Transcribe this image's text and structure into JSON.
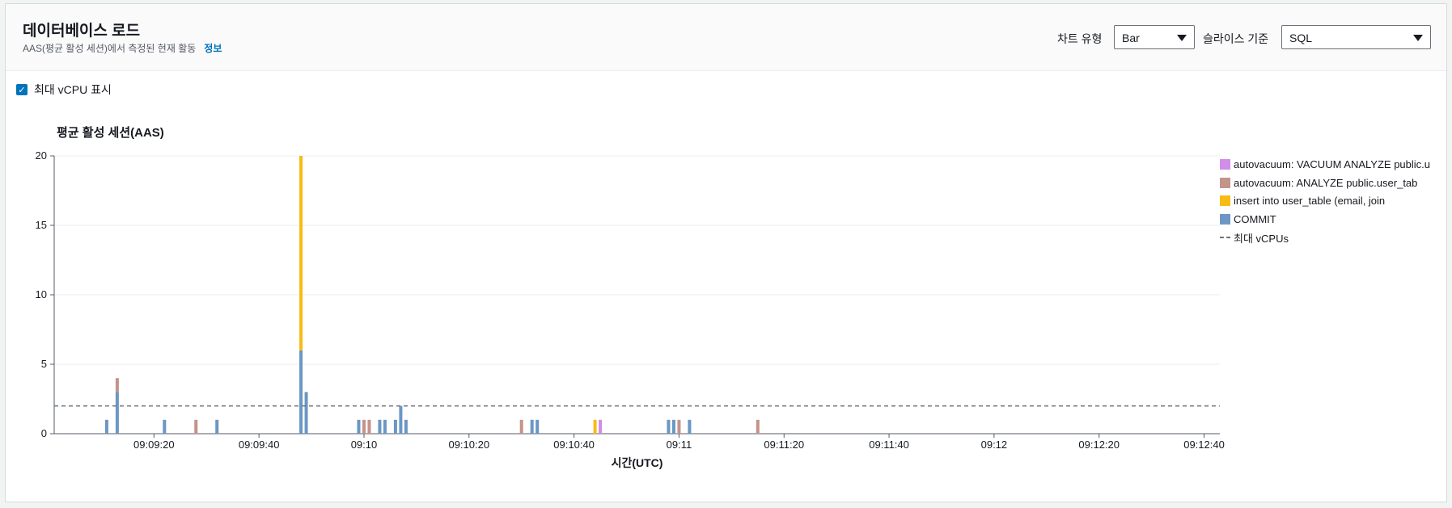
{
  "header": {
    "title": "데이터베이스 로드",
    "subtitle": "AAS(평균 활성 세션)에서 측정된 현재 활동",
    "info_link": "정보"
  },
  "controls": {
    "chart_type_label": "차트 유형",
    "chart_type_value": "Bar",
    "slice_label": "슬라이스 기준",
    "slice_value": "SQL"
  },
  "checkbox": {
    "label": "최대 vCPU 표시",
    "checked": true
  },
  "legend": [
    {
      "name": "autovacuum: VACUUM ANALYZE public.u",
      "color": "#d08ee8"
    },
    {
      "name": "autovacuum: ANALYZE public.user_tab",
      "color": "#c4938a"
    },
    {
      "name": "insert into user_table (email, join",
      "color": "#f8bb16"
    },
    {
      "name": "COMMIT",
      "color": "#6b97c4"
    }
  ],
  "max_vcpu_legend": "최대 vCPUs",
  "chart_data": {
    "type": "bar",
    "stacked": true,
    "title": "평균 활성 세션(AAS)",
    "xlabel": "시간(UTC)",
    "ylabel": "",
    "ylim": [
      0,
      20
    ],
    "yticks": [
      0,
      5,
      10,
      15,
      20
    ],
    "xrange": [
      "09:09:01",
      "09:12:43"
    ],
    "xticks": [
      {
        "time": "09:09:20",
        "label": "09:09:20"
      },
      {
        "time": "09:09:40",
        "label": "09:09:40"
      },
      {
        "time": "09:10:00",
        "label": "09:10"
      },
      {
        "time": "09:10:20",
        "label": "09:10:20"
      },
      {
        "time": "09:10:40",
        "label": "09:10:40"
      },
      {
        "time": "09:11:00",
        "label": "09:11"
      },
      {
        "time": "09:11:20",
        "label": "09:11:20"
      },
      {
        "time": "09:11:40",
        "label": "09:11:40"
      },
      {
        "time": "09:12:00",
        "label": "09:12"
      },
      {
        "time": "09:12:20",
        "label": "09:12:20"
      },
      {
        "time": "09:12:40",
        "label": "09:12:40"
      }
    ],
    "max_vcpu": 2,
    "grid": true,
    "legend_position": "right",
    "series": [
      {
        "name": "COMMIT",
        "color": "#6b97c4",
        "values": [
          [
            "09:09:11",
            1
          ],
          [
            "09:09:13",
            3
          ],
          [
            "09:09:22",
            1
          ],
          [
            "09:09:32",
            1
          ],
          [
            "09:09:48",
            6
          ],
          [
            "09:09:49",
            3
          ],
          [
            "09:09:59",
            1
          ],
          [
            "09:10:03",
            1
          ],
          [
            "09:10:04",
            1
          ],
          [
            "09:10:06",
            1
          ],
          [
            "09:10:07",
            2
          ],
          [
            "09:10:08",
            1
          ],
          [
            "09:10:32",
            1
          ],
          [
            "09:10:33",
            1
          ],
          [
            "09:10:58",
            1
          ],
          [
            "09:10:59",
            1
          ],
          [
            "09:11:02",
            1
          ]
        ]
      },
      {
        "name": "autovacuum: ANALYZE public.user_tab",
        "color": "#c4938a",
        "values": [
          [
            "09:09:13",
            1
          ],
          [
            "09:09:28",
            1
          ],
          [
            "09:10:00",
            1
          ],
          [
            "09:10:01",
            1
          ],
          [
            "09:10:30",
            1
          ],
          [
            "09:11:00",
            1
          ],
          [
            "09:11:15",
            1
          ]
        ]
      },
      {
        "name": "insert into user_table (email, join",
        "color": "#f8bb16",
        "values": [
          [
            "09:09:48",
            14
          ],
          [
            "09:10:44",
            1
          ]
        ]
      },
      {
        "name": "autovacuum: VACUUM ANALYZE public.u",
        "color": "#d08ee8",
        "values": [
          [
            "09:10:45",
            1
          ]
        ]
      }
    ]
  }
}
